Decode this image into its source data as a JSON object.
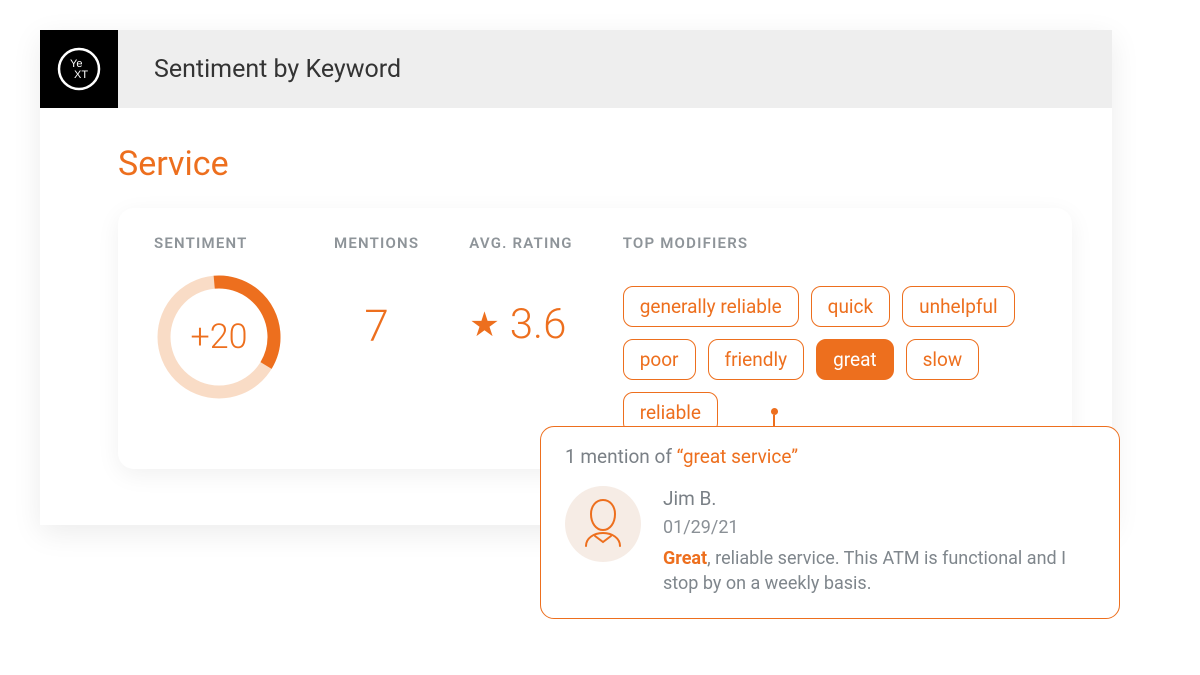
{
  "header": {
    "title": "Sentiment by Keyword",
    "logo_name": "yext"
  },
  "keyword": "Service",
  "labels": {
    "sentiment": "SENTIMENT",
    "mentions": "MENTIONS",
    "avg_rating": "AVG. RATING",
    "top_modifiers": "TOP MODIFIERS"
  },
  "sentiment": {
    "display": "+20",
    "value": 20,
    "ring_fill_pct": 35
  },
  "mentions": "7",
  "avg_rating": "3.6",
  "modifiers": [
    {
      "label": "generally reliable",
      "active": false
    },
    {
      "label": "quick",
      "active": false
    },
    {
      "label": "unhelpful",
      "active": false
    },
    {
      "label": "poor",
      "active": false
    },
    {
      "label": "friendly",
      "active": false
    },
    {
      "label": "great",
      "active": true
    },
    {
      "label": "slow",
      "active": false
    },
    {
      "label": "reliable",
      "active": false
    }
  ],
  "popover": {
    "prefix": "1 mention of ",
    "quote": "“great service”",
    "mention": {
      "author": "Jim B.",
      "date": "01/29/21",
      "highlight": "Great",
      "rest": ", reliable service. This ATM is functional and I stop by on a weekly basis."
    }
  },
  "colors": {
    "accent": "#ed6f1e"
  }
}
